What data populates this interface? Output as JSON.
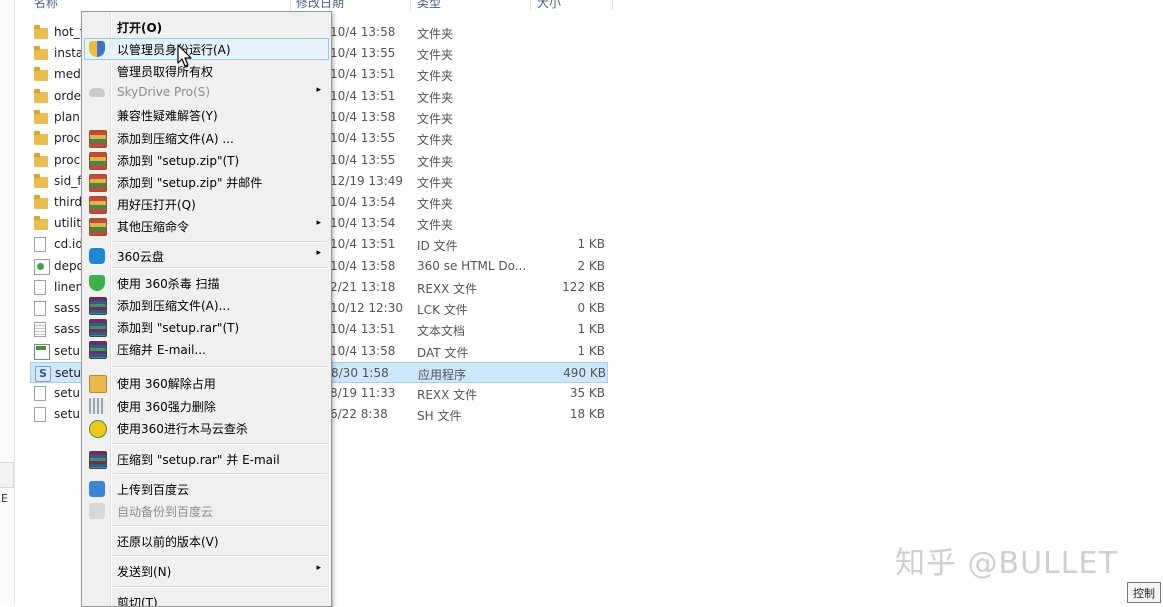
{
  "header": {
    "name": "名称",
    "date": "修改日期",
    "type": "类型",
    "size": "大小"
  },
  "files": [
    {
      "name": "hot_f",
      "date": "10/4 13:58",
      "type": "文件夹",
      "size": "",
      "icon": "folder-icon"
    },
    {
      "name": "insta",
      "date": "10/4 13:55",
      "type": "文件夹",
      "size": "",
      "icon": "folder-icon"
    },
    {
      "name": "med",
      "date": "10/4 13:51",
      "type": "文件夹",
      "size": "",
      "icon": "folder-icon"
    },
    {
      "name": "orde",
      "date": "10/4 13:51",
      "type": "文件夹",
      "size": "",
      "icon": "folder-icon"
    },
    {
      "name": "plan",
      "date": "10/4 13:58",
      "type": "文件夹",
      "size": "",
      "icon": "folder-icon"
    },
    {
      "name": "proc",
      "date": "10/4 13:55",
      "type": "文件夹",
      "size": "",
      "icon": "folder-icon"
    },
    {
      "name": "proc",
      "date": "10/4 13:55",
      "type": "文件夹",
      "size": "",
      "icon": "folder-icon"
    },
    {
      "name": "sid_f",
      "date": "12/19 13:49",
      "type": "文件夹",
      "size": "",
      "icon": "folder-icon"
    },
    {
      "name": "third",
      "date": "10/4 13:54",
      "type": "文件夹",
      "size": "",
      "icon": "folder-icon"
    },
    {
      "name": "utiliti",
      "date": "10/4 13:54",
      "type": "文件夹",
      "size": "",
      "icon": "folder-icon"
    },
    {
      "name": "cd.id",
      "date": "10/4 13:51",
      "type": "ID 文件",
      "size": "1 KB",
      "icon": "document-icon"
    },
    {
      "name": "depo",
      "date": "10/4 13:58",
      "type": "360 se HTML Do...",
      "size": "2 KB",
      "icon": "html-file-icon"
    },
    {
      "name": "linen",
      "date": "2/21 13:18",
      "type": "REXX 文件",
      "size": "122 KB",
      "icon": "document-icon"
    },
    {
      "name": "sass",
      "date": "10/12 12:30",
      "type": "LCK 文件",
      "size": "0 KB",
      "icon": "document-icon"
    },
    {
      "name": "sass",
      "date": "10/4 13:51",
      "type": "文本文档",
      "size": "1 KB",
      "icon": "text-file-icon"
    },
    {
      "name": "setu",
      "date": "10/4 13:58",
      "type": "DAT 文件",
      "size": "1 KB",
      "icon": "dat-file-icon"
    },
    {
      "name": "setu",
      "date": "8/30 1:58",
      "type": "应用程序",
      "size": "490 KB",
      "icon": "app-icon",
      "selected": true
    },
    {
      "name": "setu",
      "date": "8/19 11:33",
      "type": "REXX 文件",
      "size": "35 KB",
      "icon": "document-icon"
    },
    {
      "name": "setu",
      "date": "6/22 8:38",
      "type": "SH 文件",
      "size": "18 KB",
      "icon": "document-icon"
    }
  ],
  "context_menu": {
    "items": [
      {
        "label": "打开(O)",
        "bold": true,
        "icon": ""
      },
      {
        "label": "以管理员身份运行(A)",
        "icon": "uac-shield-icon",
        "highlighted": true
      },
      {
        "label": "管理员取得所有权",
        "icon": ""
      },
      {
        "label": "SkyDrive Pro(S)",
        "icon": "skydrive-cloud-icon",
        "disabled": true,
        "submenu": true
      },
      {
        "label": "兼容性疑难解答(Y)",
        "icon": ""
      },
      {
        "label": "添加到压缩文件(A) ...",
        "icon": "archive-icon"
      },
      {
        "label": "添加到 \"setup.zip\"(T)",
        "icon": "archive-icon"
      },
      {
        "label": "添加到 \"setup.zip\" 并邮件",
        "icon": "archive-icon"
      },
      {
        "label": "用好压打开(Q)",
        "icon": "archive-icon"
      },
      {
        "label": "其他压缩命令",
        "icon": "archive-icon",
        "submenu": true
      },
      {
        "label": "360云盘",
        "icon": "cloud-360-icon",
        "submenu": true
      },
      {
        "label": "使用 360杀毒 扫描",
        "icon": "antivirus-shield-icon"
      },
      {
        "label": "添加到压缩文件(A)...",
        "icon": "winrar-icon"
      },
      {
        "label": "添加到 \"setup.rar\"(T)",
        "icon": "winrar-icon"
      },
      {
        "label": "压缩并 E-mail...",
        "icon": "winrar-icon"
      },
      {
        "label": "使用 360解除占用",
        "icon": "unlock-folder-icon"
      },
      {
        "label": "使用 360强力删除",
        "icon": "shredder-icon"
      },
      {
        "label": "使用360进行木马云查杀",
        "icon": "trojan-scan-icon"
      },
      {
        "label": "压缩到 \"setup.rar\" 并 E-mail",
        "icon": "winrar-icon"
      },
      {
        "label": "上传到百度云",
        "icon": "baidu-cloud-icon"
      },
      {
        "label": "自动备份到百度云",
        "icon": "baidu-backup-icon",
        "disabled": true
      },
      {
        "label": "还原以前的版本(V)",
        "icon": ""
      },
      {
        "label": "发送到(N)",
        "icon": "",
        "submenu": true
      },
      {
        "label": "剪切(T)",
        "icon": ""
      }
    ],
    "submenu_arrow": "▸"
  },
  "watermark": "知乎 @BULLET",
  "corner_button": "控制",
  "left_edge_glyph": "E"
}
